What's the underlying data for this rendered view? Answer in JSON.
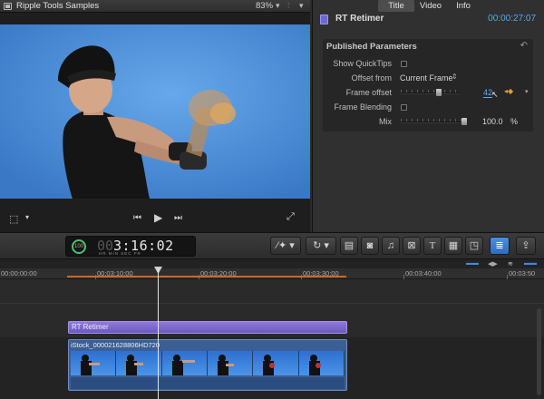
{
  "viewer": {
    "title": "Ripple Tools Samples",
    "zoom": "83%",
    "icons": [
      "film-icon",
      "zoom-dropdown-icon",
      "switch-icon",
      "viewer-options-icon"
    ],
    "controls": [
      "transform-icon",
      "previous-edit-icon",
      "play-icon",
      "next-edit-icon",
      "fullscreen-icon"
    ]
  },
  "inspector": {
    "tabs": [
      "Title",
      "Video",
      "Info"
    ],
    "active_tab": "Title",
    "plugin_name": "RT Retimer",
    "timecode": "00:00:27:07",
    "section_title": "Published Parameters",
    "params": {
      "show_quicktips": {
        "label": "Show QuickTips"
      },
      "offset_from": {
        "label": "Offset from",
        "value": "Current Frame"
      },
      "frame_offset": {
        "label": "Frame offset",
        "value": "42",
        "slider_fraction": 0.66
      },
      "frame_blending": {
        "label": "Frame Blending"
      },
      "mix": {
        "label": "Mix",
        "value": "100.0",
        "unit": "%",
        "slider_fraction": 1.0
      }
    }
  },
  "toolbar": {
    "timecode": "3:16:02",
    "timecode_units": "HR   MIN  SEC  FR",
    "progress_label": "100",
    "accent_color": "#3f84de"
  },
  "timeline": {
    "ruler_labels": [
      "00:00:00:00",
      "00:03:10:00",
      "00:03:20:00",
      "00:03:30:00",
      "00:03:40:00",
      "00:03:50"
    ],
    "title_clip": "RT Retimer",
    "video_clip": "iStock_000021628806HD720"
  }
}
